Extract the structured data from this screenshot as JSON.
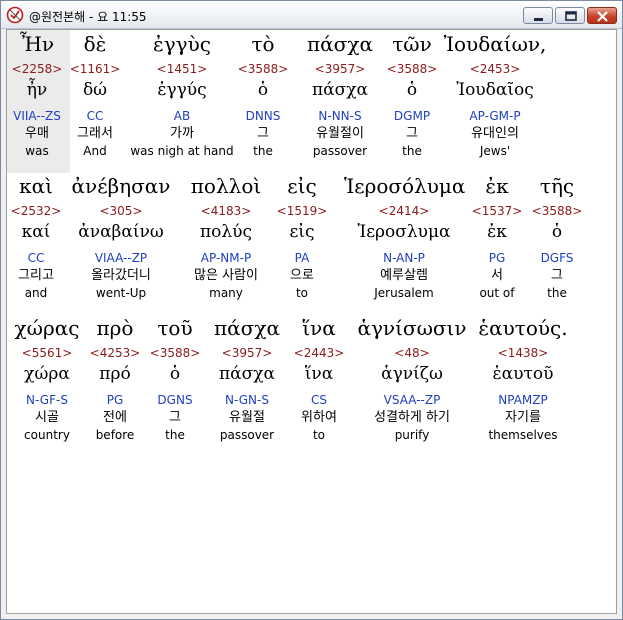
{
  "window": {
    "title": "@원전본해 - 요 11:55",
    "app_icon": "bible-app-icon",
    "controls": [
      "minimize-icon",
      "maximize-icon",
      "close-icon"
    ]
  },
  "verse_reference": "요 11:55",
  "rows": [
    {
      "words": [
        {
          "greek": "Ἦν",
          "strong": "<2258>",
          "lemma": "ἦν",
          "parse": "VIIA--ZS",
          "korean": "우매",
          "english": "was"
        },
        {
          "greek": "δὲ",
          "strong": "<1161>",
          "lemma": "δώ",
          "parse": "CC",
          "korean": "그래서",
          "english": "And"
        },
        {
          "greek": "ἐγγὺς",
          "strong": "<1451>",
          "lemma": "ἐγγύς",
          "parse": "AB",
          "korean": "가까",
          "english": "was nigh at hand"
        },
        {
          "greek": "τὸ",
          "strong": "<3588>",
          "lemma": "ὁ",
          "parse": "DNNS",
          "korean": "그",
          "english": "the"
        },
        {
          "greek": "πάσχα",
          "strong": "<3957>",
          "lemma": "πάσχα",
          "parse": "N-NN-S",
          "korean": "유월절이",
          "english": "passover"
        },
        {
          "greek": "τῶν",
          "strong": "<3588>",
          "lemma": "ὁ",
          "parse": "DGMP",
          "korean": "그",
          "english": "the"
        },
        {
          "greek": "Ἰουδαίων,",
          "strong": "<2453>",
          "lemma": "Ἰουδαῖος",
          "parse": "AP-GM-P",
          "korean": "유대인의",
          "english": "Jews'"
        }
      ]
    },
    {
      "words": [
        {
          "greek": "καὶ",
          "strong": "<2532>",
          "lemma": "καί",
          "parse": "CC",
          "korean": "그리고",
          "english": "and"
        },
        {
          "greek": "ἀνέβησαν",
          "strong": "<305>",
          "lemma": "ἀναβαίνω",
          "parse": "VIAA--ZP",
          "korean": "올라갔더니",
          "english": "went-Up"
        },
        {
          "greek": "πολλοὶ",
          "strong": "<4183>",
          "lemma": "πολύς",
          "parse": "AP-NM-P",
          "korean": "많은 사람이",
          "english": "many"
        },
        {
          "greek": "εἰς",
          "strong": "<1519>",
          "lemma": "εἰς",
          "parse": "PA",
          "korean": "으로",
          "english": "to"
        },
        {
          "greek": "Ἱεροσόλυμα",
          "strong": "<2414>",
          "lemma": "Ἱεροσλυμα",
          "parse": "N-AN-P",
          "korean": "예루살렘",
          "english": "Jerusalem"
        },
        {
          "greek": "ἐκ",
          "strong": "<1537>",
          "lemma": "ἐκ",
          "parse": "PG",
          "korean": "서",
          "english": "out of"
        },
        {
          "greek": "τῆς",
          "strong": "<3588>",
          "lemma": "ὁ",
          "parse": "DGFS",
          "korean": "그",
          "english": "the"
        }
      ]
    },
    {
      "words": [
        {
          "greek": "χώρας",
          "strong": "<5561>",
          "lemma": "χώρα",
          "parse": "N-GF-S",
          "korean": "시골",
          "english": "country"
        },
        {
          "greek": "πρὸ",
          "strong": "<4253>",
          "lemma": "πρό",
          "parse": "PG",
          "korean": "전에",
          "english": "before"
        },
        {
          "greek": "τοῦ",
          "strong": "<3588>",
          "lemma": "ὁ",
          "parse": "DGNS",
          "korean": "그",
          "english": "the"
        },
        {
          "greek": "πάσχα",
          "strong": "<3957>",
          "lemma": "πάσχα",
          "parse": "N-GN-S",
          "korean": "유월절",
          "english": "passover"
        },
        {
          "greek": "ἵνα",
          "strong": "<2443>",
          "lemma": "ἵνα",
          "parse": "CS",
          "korean": "위하여",
          "english": "to"
        },
        {
          "greek": "ἁγνίσωσιν",
          "strong": "<48>",
          "lemma": "ἁγνίζω",
          "parse": "VSAA--ZP",
          "korean": "성결하게 하기",
          "english": "purify"
        },
        {
          "greek": "ἑαυτούς.",
          "strong": "<1438>",
          "lemma": "ἑαυτοῦ",
          "parse": "NPAMZP",
          "korean": "자기를",
          "english": "themselves"
        }
      ]
    }
  ]
}
